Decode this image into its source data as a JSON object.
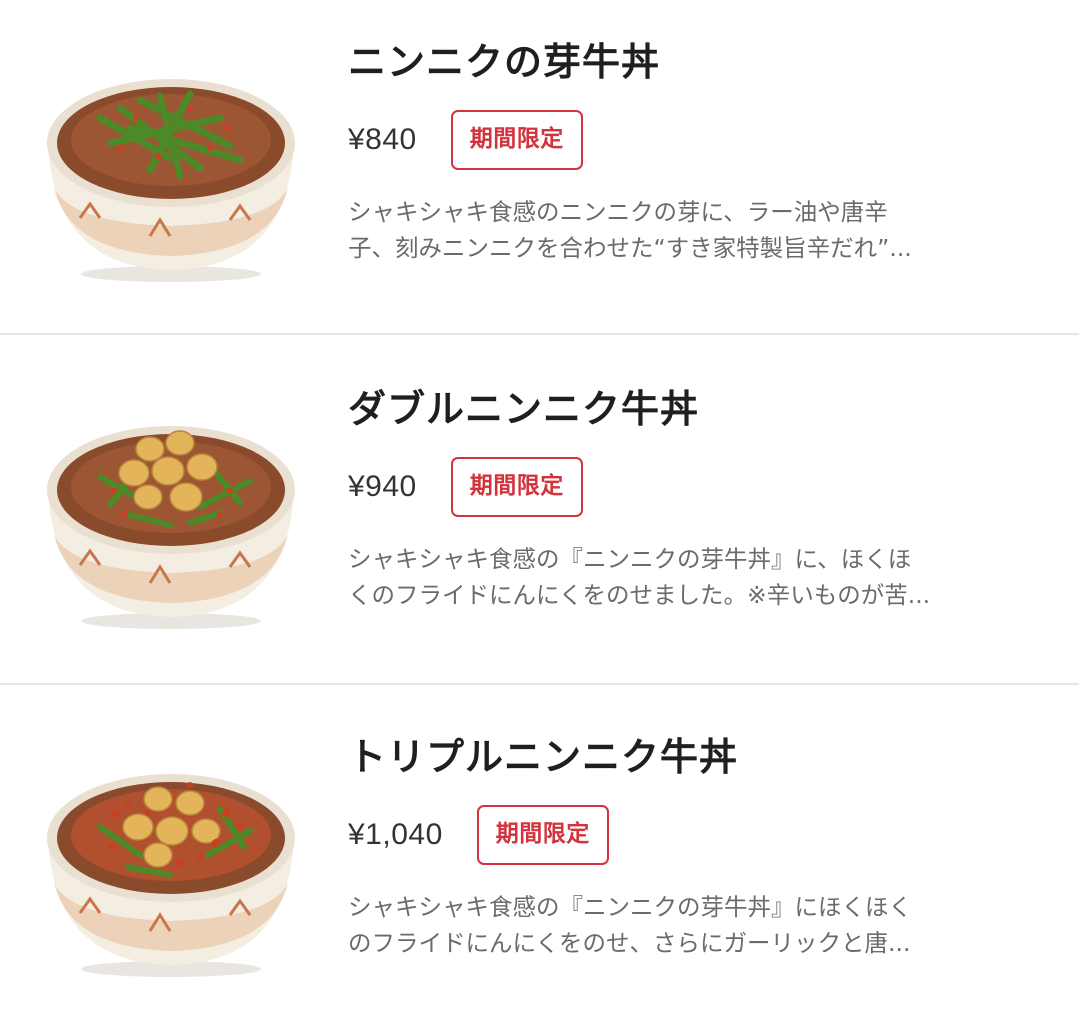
{
  "menu_items": [
    {
      "title": "ニンニクの芽牛丼",
      "price": "¥840",
      "badge": "期間限定",
      "description_line1": "シャキシャキ食感のニンニクの芽に、ラー油や唐辛",
      "description_line2": "子、刻みニンニクを合わせた“すき家特製旨辛だれ”..."
    },
    {
      "title": "ダブルニンニク牛丼",
      "price": "¥940",
      "badge": "期間限定",
      "description_line1": "シャキシャキ食感の『ニンニクの芽牛丼』に、ほくほ",
      "description_line2": "くのフライドにんにくをのせました。※辛いものが苦..."
    },
    {
      "title": "トリプルニンニク牛丼",
      "price": "¥1,040",
      "badge": "期間限定",
      "description_line1": "シャキシャキ食感の『ニンニクの芽牛丼』にほくほく",
      "description_line2": "のフライドにんにくをのせ、さらにガーリックと唐..."
    }
  ],
  "colors": {
    "badge_red": "#d2333d",
    "title_text": "#1f1f1f",
    "description_text": "#6b6b6b",
    "divider": "#e6e6e6"
  }
}
